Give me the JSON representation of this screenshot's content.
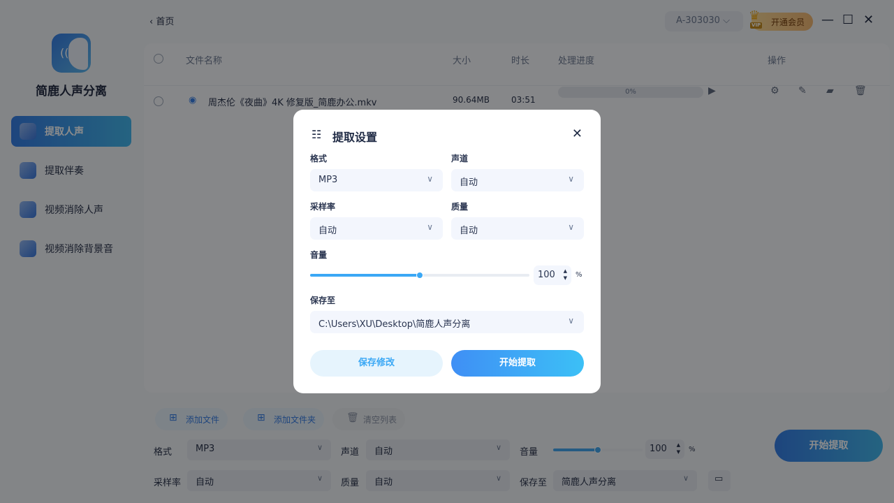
{
  "app": {
    "name": "简鹿人声分离"
  },
  "sidebar": {
    "items": [
      {
        "label": "提取人声",
        "active": true
      },
      {
        "label": "提取伴奏"
      },
      {
        "label": "视频消除人声"
      },
      {
        "label": "视频消除背景音"
      }
    ]
  },
  "topbar": {
    "back": "首页",
    "account": "A-303030",
    "vip": "开通会员",
    "vip_badge": "VIP"
  },
  "table": {
    "headers": {
      "name": "文件名称",
      "size": "大小",
      "duration": "时长",
      "progress": "处理进度",
      "actions": "操作"
    },
    "rows": [
      {
        "name": "周杰伦《夜曲》4K 修复版_简鹿办公.mkv",
        "size": "90.64MB",
        "duration": "03:51",
        "progress": "0%"
      }
    ]
  },
  "toolbar": {
    "add_file": "添加文件",
    "add_folder": "添加文件夹",
    "clear": "清空列表"
  },
  "settings": {
    "format_label": "格式",
    "format": "MP3",
    "channel_label": "声道",
    "channel": "自动",
    "volume_label": "音量",
    "volume": "100",
    "volume_fraction": 0.5,
    "pct": "%",
    "rate_label": "采样率",
    "rate": "自动",
    "quality_label": "质量",
    "quality": "自动",
    "save_label": "保存至",
    "save": "简鹿人声分离",
    "start": "开始提取"
  },
  "modal": {
    "title": "提取设置",
    "format_label": "格式",
    "format": "MP3",
    "channel_label": "声道",
    "channel": "自动",
    "rate_label": "采样率",
    "rate": "自动",
    "quality_label": "质量",
    "quality": "自动",
    "volume_label": "音量",
    "volume": "100",
    "volume_fraction": 0.5,
    "pct": "%",
    "save_label": "保存至",
    "save_path": "C:\\Users\\XU\\Desktop\\简鹿人声分离",
    "save_button": "保存修改",
    "start_button": "开始提取"
  }
}
